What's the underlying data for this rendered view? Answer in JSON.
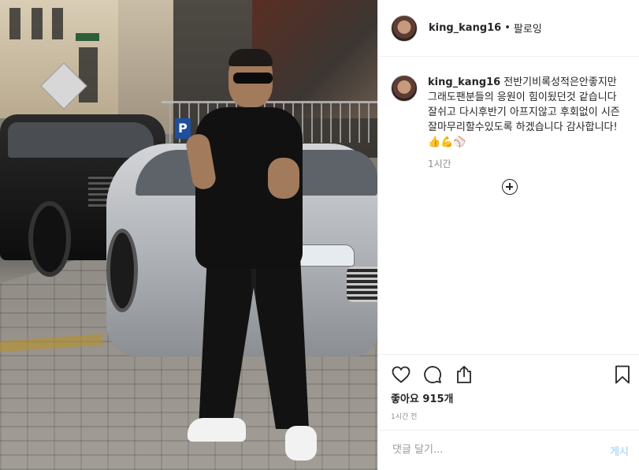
{
  "post": {
    "username": "king_kang16",
    "header_separator": "•",
    "follow_label": "팔로잉",
    "caption_text": "전반기비록성적은안좋지만 그래도팬분들의 응원이 힘이됬던것 같습니다 잘쉬고 다시후반기 아프지않고 후회없이 시즌잘마무리할수있도록 하겠습니다 감사합니다!👍💪⚾",
    "caption_time": "1시간",
    "likes_text": "좋아요 915개",
    "posted_time": "1시간 전",
    "comment_placeholder": "댓글 달기...",
    "post_button_label": "게시"
  },
  "icons": {
    "like": "heart-icon",
    "comment": "speech-bubble-icon",
    "share": "share-icon",
    "save": "bookmark-icon",
    "more_replies": "plus-circle-icon"
  },
  "colors": {
    "text": "#262626",
    "secondary_text": "#8e8e8e",
    "post_button_disabled": "#b3dbff",
    "divider": "#efefef"
  }
}
